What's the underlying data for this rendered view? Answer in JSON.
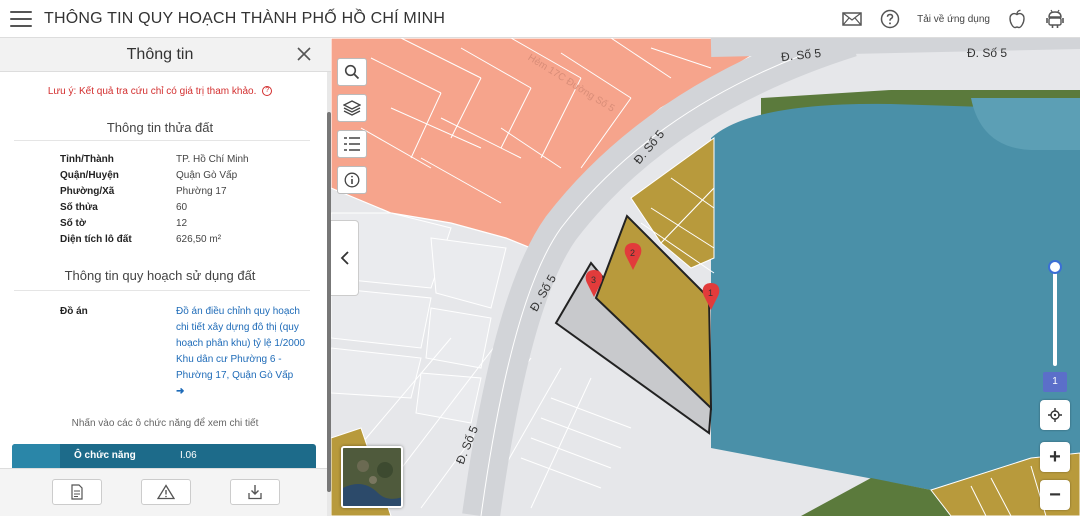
{
  "header": {
    "title": "THÔNG TIN QUY HOẠCH THÀNH PHỐ HỒ CHÍ MINH",
    "download_label": "Tải về ứng dụng",
    "icons": [
      "menu-icon",
      "mail-icon",
      "help-icon",
      "apple-icon",
      "android-icon"
    ]
  },
  "panel": {
    "title": "Thông tin",
    "note": "Lưu ý: Kết quả tra cứu chỉ có giá trị tham khảo.",
    "note_icon": "?",
    "parcel_section_title": "Thông tin thửa đất",
    "parcel_rows": [
      {
        "label": "Tỉnh/Thành",
        "value": "TP. Hồ Chí Minh"
      },
      {
        "label": "Quận/Huyện",
        "value": "Quận Gò Vấp"
      },
      {
        "label": "Phường/Xã",
        "value": "Phường 17"
      },
      {
        "label": "Số thửa",
        "value": "60"
      },
      {
        "label": "Số tờ",
        "value": "12"
      },
      {
        "label": "Diện tích lô đất",
        "value": "626,50 m²"
      }
    ],
    "landuse_section_title": "Thông tin quy hoạch sử dụng đất",
    "plan_label": "Đồ án",
    "plan_link": "Đồ án điều chỉnh quy hoạch chi tiết xây dựng đô thị (quy hoạch phân khu) tỷ lệ 1/2000 Khu dân cư Phường 6 - Phường 17, Quận Gò Vấp",
    "plan_arrow": "➜",
    "hint": "Nhấn vào các ô chức năng để xem chi tiết",
    "function_cell": {
      "label": "Ô chức năng",
      "value": "I.06"
    },
    "footer_icons": [
      "document-icon",
      "warning-icon",
      "download-icon"
    ]
  },
  "map": {
    "street_labels": [
      "Đ. Số 5",
      "Đ. Số 5",
      "Đ. Số 5",
      "Đ. Số 5",
      "Đ. Số 5"
    ],
    "faded_label": "Hẻm 17C Đường Số 5",
    "pins": [
      "1",
      "2",
      "3"
    ],
    "zoom_level": "1",
    "zoom_in": "+",
    "zoom_out": "−",
    "colors": {
      "residential": "#f6a48c",
      "water": "#4a90a8",
      "parcel": "#b89a3c",
      "green": "#5b7a3c",
      "road": "#d2d4d8",
      "background": "#e6e7ea",
      "pin": "#e23b3b"
    }
  }
}
